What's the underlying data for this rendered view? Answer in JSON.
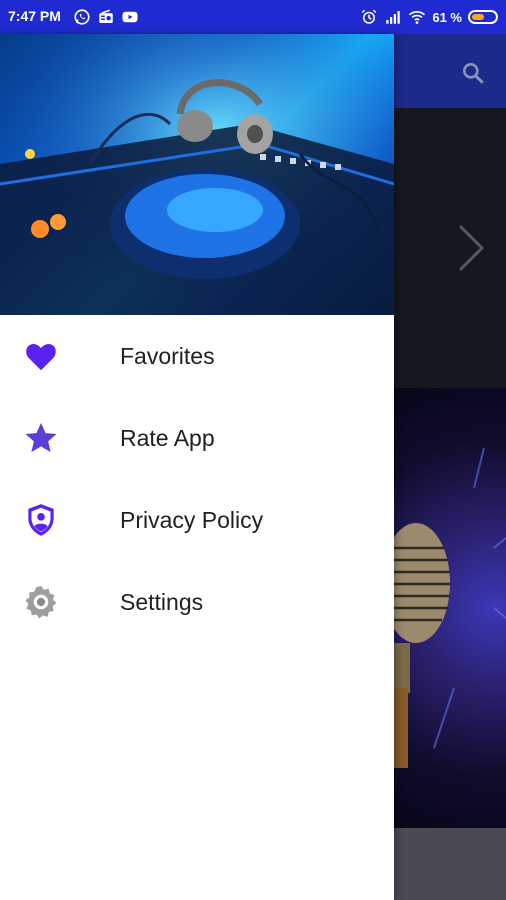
{
  "status_bar": {
    "time": "7:47 PM",
    "battery_text": "61 %",
    "battery_level": 0.61,
    "icons": [
      "whatsapp-icon",
      "radio-icon",
      "youtube-icon",
      "alarm-icon",
      "signal-icon",
      "wifi-icon"
    ]
  },
  "colors": {
    "status_bar": "#1f2bd0",
    "accent": "#5b21f0",
    "battery_fill": "#f6a623",
    "settings_icon": "#9e9e9e"
  },
  "drawer": {
    "header_image": "dj-turntable-headphones",
    "menu": [
      {
        "id": "favorites",
        "label": "Favorites",
        "icon": "heart-icon"
      },
      {
        "id": "rate",
        "label": "Rate App",
        "icon": "star-icon"
      },
      {
        "id": "privacy",
        "label": "Privacy Policy",
        "icon": "shield-user-icon"
      },
      {
        "id": "settings",
        "label": "Settings",
        "icon": "gear-icon"
      }
    ]
  },
  "background_app": {
    "toolbar_icon": "search-icon",
    "carousel_icon": "chevron-right-icon",
    "stage_image": "microphone"
  }
}
